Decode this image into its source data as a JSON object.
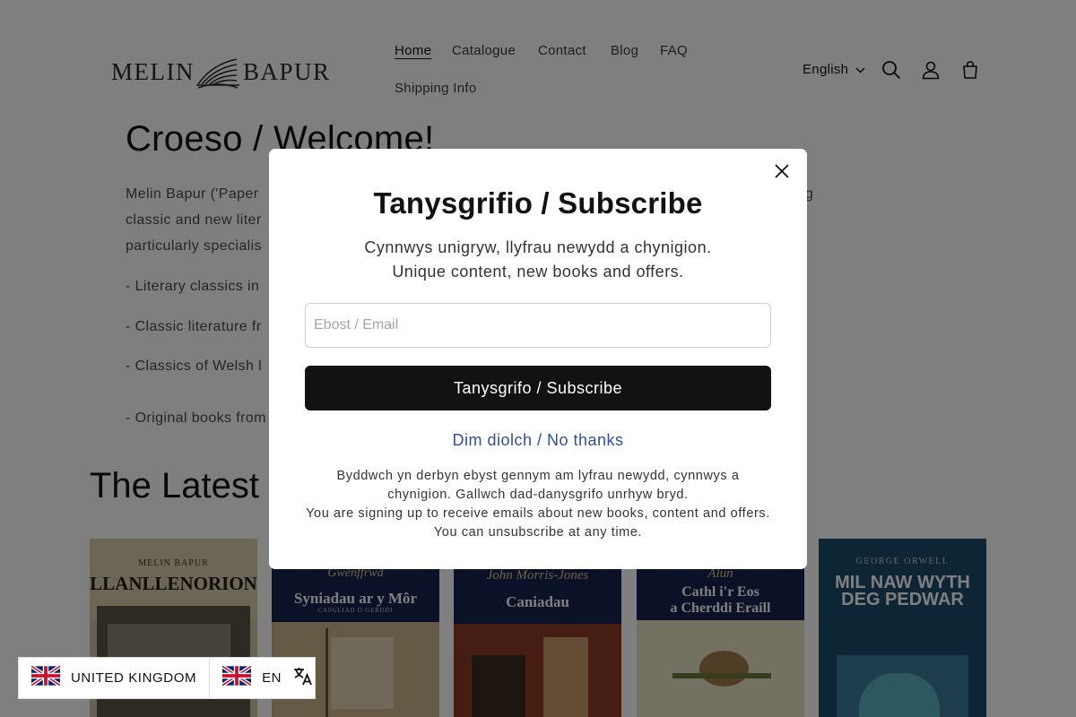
{
  "brand": {
    "logo_text": "MELIN BAPUR"
  },
  "nav": {
    "items": [
      {
        "label": "Home"
      },
      {
        "label": "Catalogue"
      },
      {
        "label": "Contact"
      },
      {
        "label": "Blog"
      },
      {
        "label": "FAQ"
      },
      {
        "label": "Shipping Info"
      }
    ]
  },
  "header": {
    "language": "English"
  },
  "main": {
    "welcome_title": "Croeso / Welcome!",
    "intro_lines": [
      "Melin Bapur ('Paper",
      "classic and new liter",
      "particularly specialis"
    ],
    "intro_tail": "g",
    "bullets": [
      "- Literary classics in",
      "- Classic literature fr",
      "- Classics of Welsh l",
      "- Original books from"
    ],
    "latest_title": "The Latest"
  },
  "books": [
    {
      "author": "MELIN BAPUR",
      "title": "LLANLLENORION",
      "subtitle": ""
    },
    {
      "author": "Gwenffrwd",
      "title": "Syniadau ar y Môr",
      "subtitle": "CASGLIAD O GERDDI"
    },
    {
      "author": "John Morris-Jones",
      "title": "Caniadau",
      "subtitle": ""
    },
    {
      "author": "Alun",
      "title": "Cathl i'r Eos",
      "subtitle": "a Cherddi Eraill"
    },
    {
      "author": "GEORGE ORWELL",
      "title": "MIL NAW WYTH DEG PEDWAR",
      "subtitle": ""
    }
  ],
  "modal": {
    "title": "Tanysgrifio / Subscribe",
    "subtitle_cy": "Cynnwys unigryw, llyfrau newydd a chynigion.",
    "subtitle_en": "Unique content, new books and offers.",
    "email_placeholder": "Ebost / Email",
    "subscribe_label": "Tanysgrifo / Subscribe",
    "no_thanks": "Dim diolch / No thanks",
    "fine_cy": "Byddwch yn derbyn ebyst gennym am lyfrau newydd, cynnwys a chynigion. Gallwch dad-danysgrifo unrhyw bryd.",
    "fine_en": "You are signing up to receive emails about new books, content and offers. You can unsubscribe at any time."
  },
  "localization": {
    "country": "UNITED KINGDOM",
    "language": "EN"
  },
  "icons": {
    "search": "search-icon",
    "account": "account-icon",
    "cart": "cart-icon",
    "close": "close-icon",
    "flag": "uk-flag-icon",
    "translate": "translate-icon",
    "chevron": "chevron-down-icon"
  },
  "colors": {
    "text": "#121212",
    "button": "#121212",
    "link": "#2f4f9e",
    "overlay": "rgba(0,0,0,0.5)"
  }
}
